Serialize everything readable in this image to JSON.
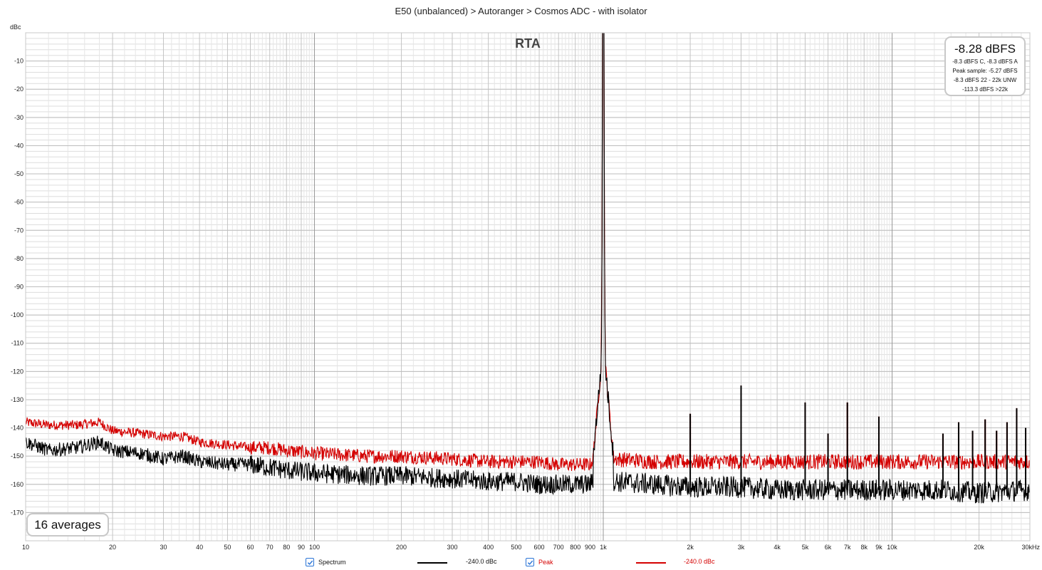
{
  "window": {
    "title": "E50 (unbalanced) > Autoranger > Cosmos ADC - with isolator"
  },
  "readout": {
    "main": "-8.28 dBFS",
    "line1": "-8.3 dBFS C, -8.3 dBFS A",
    "line2": "Peak sample: -5.27 dBFS",
    "line3": "-8.3 dBFS 22 - 22k UNW",
    "line4": "-113.3 dBFS >22k"
  },
  "averages_label": "16 averages",
  "legend": {
    "items": [
      {
        "label": "Spectrum",
        "value": "-240.0 dBc",
        "color": "#000000",
        "checked": true
      },
      {
        "label": "Peak",
        "value": "-240.0 dBc",
        "color": "#d40000",
        "checked": true
      }
    ]
  },
  "colors": {
    "spectrum": "#000000",
    "peak": "#d40000",
    "grid_major": "#9a9a9a",
    "grid_minor": "#dddddd",
    "checkbox": "#2a74d6"
  },
  "chart_data": {
    "type": "line",
    "title": "RTA",
    "ylabel": "dBc",
    "xlabel": "",
    "x_scale": "log",
    "xlim": [
      10,
      30000
    ],
    "ylim": [
      -180,
      0
    ],
    "grid": true,
    "legend_position": "bottom",
    "y_ticks": [
      -10,
      -20,
      -30,
      -40,
      -50,
      -60,
      -70,
      -80,
      -90,
      -100,
      -110,
      -120,
      -130,
      -140,
      -150,
      -160,
      -170
    ],
    "y_tick_labels": [
      "-10",
      "-20",
      "-30",
      "-40",
      "-50",
      "-60",
      "-70",
      "-80",
      "-90",
      "-100",
      "-110",
      "-120",
      "-130",
      "-140",
      "-150",
      "-160",
      "-170"
    ],
    "x_ticks": [
      10,
      20,
      30,
      40,
      50,
      60,
      70,
      80,
      90,
      100,
      200,
      300,
      400,
      500,
      600,
      700,
      800,
      900,
      1000,
      2000,
      3000,
      4000,
      5000,
      6000,
      7000,
      8000,
      9000,
      10000,
      20000,
      30000
    ],
    "x_tick_labels": [
      "10",
      "20",
      "30",
      "40",
      "50",
      "60",
      "70",
      "80",
      "90",
      "100",
      "200",
      "300",
      "400",
      "500",
      "600",
      "700",
      "800",
      "900",
      "1k",
      "2k",
      "3k",
      "4k",
      "5k",
      "6k",
      "7k",
      "8k",
      "9k",
      "10k",
      "20k",
      "30kHz"
    ],
    "fundamental": {
      "frequency": 1000,
      "level": 0
    },
    "series": [
      {
        "name": "Spectrum",
        "x": [
          10,
          12,
          15,
          18,
          20,
          25,
          30,
          35,
          40,
          50,
          60,
          70,
          80,
          100,
          150,
          200,
          300,
          400,
          500,
          600,
          700,
          800,
          900,
          950,
          980,
          1000,
          1020,
          1050,
          1100,
          1500,
          2000,
          3000,
          4000,
          5000,
          7000,
          10000,
          15000,
          20000,
          30000
        ],
        "y": [
          -145,
          -148,
          -147,
          -145,
          -148,
          -149,
          -151,
          -150,
          -152,
          -153,
          -153,
          -154,
          -155,
          -156,
          -157,
          -157,
          -158,
          -159,
          -159,
          -160,
          -160,
          -160,
          -160,
          -157,
          -150,
          0,
          -150,
          -157,
          -159,
          -160,
          -161,
          -161,
          -162,
          -162,
          -162,
          -162,
          -162,
          -163,
          -162
        ],
        "harmonics": [
          {
            "x": 2000,
            "y": -135
          },
          {
            "x": 3000,
            "y": -125
          },
          {
            "x": 5000,
            "y": -131
          },
          {
            "x": 6000,
            "y": -142
          },
          {
            "x": 7000,
            "y": -131
          },
          {
            "x": 9000,
            "y": -136
          },
          {
            "x": 15000,
            "y": -142
          },
          {
            "x": 17000,
            "y": -138
          },
          {
            "x": 19000,
            "y": -141
          },
          {
            "x": 21000,
            "y": -137
          },
          {
            "x": 23000,
            "y": -141
          },
          {
            "x": 25000,
            "y": -138
          },
          {
            "x": 27000,
            "y": -133
          },
          {
            "x": 29000,
            "y": -140
          }
        ]
      },
      {
        "name": "Peak",
        "x": [
          10,
          12,
          15,
          18,
          20,
          25,
          30,
          35,
          40,
          50,
          60,
          70,
          80,
          100,
          150,
          200,
          300,
          400,
          500,
          600,
          700,
          800,
          900,
          950,
          980,
          1000,
          1020,
          1050,
          1100,
          1500,
          2000,
          3000,
          4000,
          5000,
          7000,
          10000,
          15000,
          20000,
          30000
        ],
        "y": [
          -138,
          -139,
          -139,
          -138,
          -141,
          -142,
          -143,
          -143,
          -145,
          -146,
          -147,
          -147,
          -148,
          -149,
          -150,
          -150,
          -151,
          -152,
          -152,
          -152,
          -153,
          -153,
          -153,
          -149,
          -142,
          0,
          -142,
          -149,
          -151,
          -152,
          -152,
          -152,
          -152,
          -152,
          -152,
          -152,
          -152,
          -152,
          -152
        ],
        "harmonics": [
          {
            "x": 2000,
            "y": -135
          },
          {
            "x": 3000,
            "y": -125
          },
          {
            "x": 5000,
            "y": -131
          },
          {
            "x": 6000,
            "y": -142
          },
          {
            "x": 7000,
            "y": -131
          },
          {
            "x": 9000,
            "y": -136
          },
          {
            "x": 15000,
            "y": -142
          },
          {
            "x": 17000,
            "y": -138
          },
          {
            "x": 19000,
            "y": -141
          },
          {
            "x": 21000,
            "y": -137
          },
          {
            "x": 23000,
            "y": -141
          },
          {
            "x": 25000,
            "y": -138
          },
          {
            "x": 27000,
            "y": -133
          },
          {
            "x": 29000,
            "y": -140
          }
        ]
      }
    ]
  }
}
